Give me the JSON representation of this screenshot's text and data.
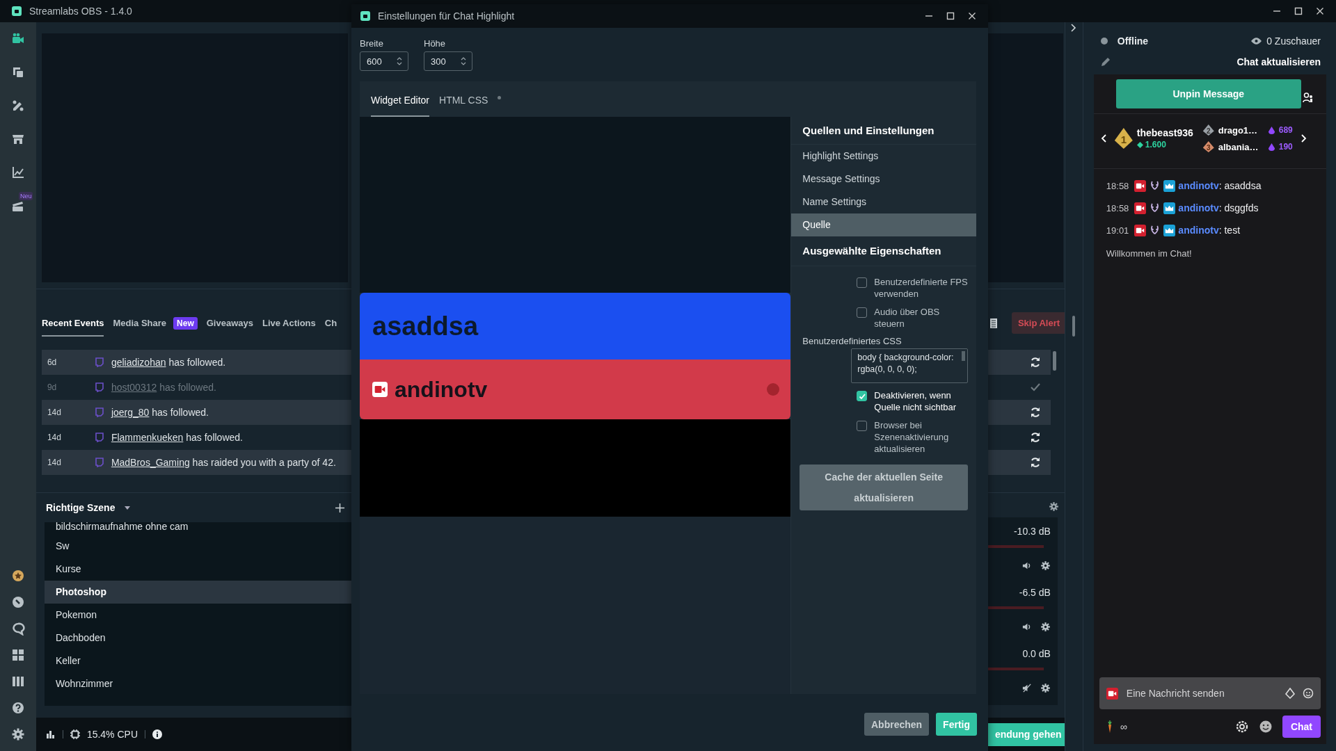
{
  "app": {
    "title": "Streamlabs OBS - 1.4.0"
  },
  "nav_items": [
    {
      "selected": true
    },
    {
      "selected": false
    },
    {
      "selected": false
    },
    {
      "selected": false
    },
    {
      "selected": false
    },
    {
      "selected": false,
      "badge": "Neu"
    }
  ],
  "dock_tabs": [
    {
      "label": "Recent Events",
      "selected": true
    },
    {
      "label": "Media Share",
      "badge": "New",
      "selected": false
    },
    {
      "label": "Giveaways",
      "selected": false
    },
    {
      "label": "Live Actions",
      "selected": false
    },
    {
      "label": "Ch",
      "selected": false
    }
  ],
  "skip_alert": "Skip Alert",
  "events": [
    {
      "age": "6d",
      "user": "geliadizohan",
      "text": " has followed.",
      "dimmed": false,
      "kind": "refresh"
    },
    {
      "age": "9d",
      "user": "host00312",
      "text": " has followed.",
      "dimmed": true,
      "kind": "check"
    },
    {
      "age": "14d",
      "user": "joerg_80",
      "text": " has followed.",
      "dimmed": false,
      "kind": "refresh"
    },
    {
      "age": "14d",
      "user": "Flammenkueken",
      "text": " has followed.",
      "dimmed": false,
      "kind": "refresh"
    },
    {
      "age": "14d",
      "user": "MadBros_Gaming",
      "text": " has raided you with a party of 42.",
      "dimmed": false,
      "kind": "refresh"
    }
  ],
  "scenes": {
    "title": "Richtige Szene",
    "items": [
      {
        "name": "bildschirmaufnahme ohne cam",
        "selected": false
      },
      {
        "name": "Sw",
        "selected": false
      },
      {
        "name": "Kurse",
        "selected": false
      },
      {
        "name": "Photoshop",
        "selected": true
      },
      {
        "name": "Pokemon",
        "selected": false
      },
      {
        "name": "Dachboden",
        "selected": false
      },
      {
        "name": "Keller",
        "selected": false
      },
      {
        "name": "Wohnzimmer",
        "selected": false
      }
    ]
  },
  "mixer": [
    {
      "reading": "-10.3 dB",
      "muted": false
    },
    {
      "reading": "-6.5 dB",
      "muted": false
    },
    {
      "reading": "0.0 dB",
      "muted": true
    }
  ],
  "status": {
    "cpu": "15.4% CPU"
  },
  "go_live": "endung gehen",
  "dialog": {
    "title": "Einstellungen für Chat Highlight",
    "fields": [
      {
        "label": "Breite",
        "value": "600"
      },
      {
        "label": "Höhe",
        "value": "300"
      }
    ],
    "tabs": [
      {
        "label": "Widget Editor",
        "selected": true
      },
      {
        "label": "HTML CSS",
        "selected": false
      }
    ],
    "preview": {
      "message": "asaddsa",
      "user": "andinotv"
    },
    "settings_title": "Quellen und Einstellungen",
    "sections": [
      {
        "label": "Highlight Settings",
        "selected": false
      },
      {
        "label": "Message Settings",
        "selected": false
      },
      {
        "label": "Name Settings",
        "selected": false
      },
      {
        "label": "Quelle",
        "selected": true
      }
    ],
    "properties_title": "Ausgewählte Eigenschaften",
    "properties": [
      {
        "kind": "checkbox",
        "label": "Benutzerdefinierte FPS verwenden",
        "checked": false
      },
      {
        "kind": "checkbox",
        "label": "Audio über OBS steuern",
        "checked": false
      },
      {
        "kind": "textarea",
        "label": "Benutzerdefiniertes CSS",
        "value": "body { background-color: rgba(0, 0, 0, 0);"
      },
      {
        "kind": "checkbox",
        "label": "Deaktivieren, wenn Quelle nicht sichtbar",
        "checked": true
      },
      {
        "kind": "checkbox",
        "label": "Browser bei Szenenaktivierung aktualisieren",
        "checked": false
      }
    ],
    "cache_button": "Cache der aktuellen Seite aktualisieren",
    "buttons": [
      {
        "label": "Abbrechen",
        "kind": "secondary"
      },
      {
        "label": "Fertig",
        "kind": "primary"
      }
    ]
  },
  "chat": {
    "status": "Offline",
    "viewers": "0 Zuschauer",
    "refresh": "Chat aktualisieren",
    "unpin": "Unpin Message",
    "leaders": [
      {
        "rank": "1",
        "name": "thebeast936",
        "amount": "1.600"
      },
      {
        "rank": "2",
        "name": "drago1…",
        "amount": "689"
      },
      {
        "rank": "3",
        "name": "albania…",
        "amount": "190"
      }
    ],
    "messages": [
      {
        "time": "18:58",
        "user": "andinotv",
        "text": ": asaddsa"
      },
      {
        "time": "18:58",
        "user": "andinotv",
        "text": ": dsggfds"
      },
      {
        "time": "19:01",
        "user": "andinotv",
        "text": ": test"
      }
    ],
    "welcome": "Willkommen im Chat!",
    "placeholder": "Eine Nachricht senden",
    "points": "∞",
    "send": "Chat"
  }
}
